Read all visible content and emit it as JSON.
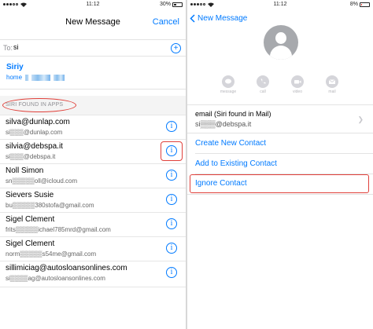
{
  "left": {
    "status": {
      "time": "11:12",
      "battery": "30%"
    },
    "nav": {
      "title": "New Message",
      "cancel": "Cancel"
    },
    "to": {
      "label": "To:",
      "value": "si",
      "add_glyph": "+"
    },
    "siri_suggestion": {
      "name": "Siriy",
      "label": "home"
    },
    "section_label": "SIRI FOUND IN APPS",
    "contacts": [
      {
        "name": "silva@dunlap.com",
        "email": "si▒▒▒@dunlap.com"
      },
      {
        "name": "silvia@debspa.it",
        "email": "si▒▒▒@debspa.it"
      },
      {
        "name": "Noll Simon",
        "email": "sn▒▒▒▒▒oll@icloud.com"
      },
      {
        "name": "Sievers Susie",
        "email": "bu▒▒▒▒▒380stofa@gmail.com"
      },
      {
        "name": "Sigel Clement",
        "email": "frits▒▒▒▒▒ichael785mrd@gmail.com"
      },
      {
        "name": "Sigel Clement",
        "email": "norm▒▒▒▒▒s54me@gmail.com"
      },
      {
        "name": "sillimiciag@autosloansonlines.com",
        "email": "si▒▒▒▒ag@autosloansonlines.com"
      }
    ],
    "info_glyph": "i"
  },
  "right": {
    "status": {
      "time": "11:12",
      "battery": "8%"
    },
    "back_label": "New Message",
    "actions": [
      {
        "label": "message",
        "icon": "message-icon"
      },
      {
        "label": "call",
        "icon": "phone-icon"
      },
      {
        "label": "video",
        "icon": "video-icon"
      },
      {
        "label": "mail",
        "icon": "mail-icon"
      }
    ],
    "email_label": "email (Siri found in Mail)",
    "email_value": "si▒▒▒@debspa.it",
    "links": {
      "create": "Create New Contact",
      "add_existing": "Add to Existing Contact",
      "ignore": "Ignore Contact"
    }
  },
  "colors": {
    "accent": "#007aff",
    "highlight": "#e0403a",
    "battery_low": "#e53b30"
  }
}
